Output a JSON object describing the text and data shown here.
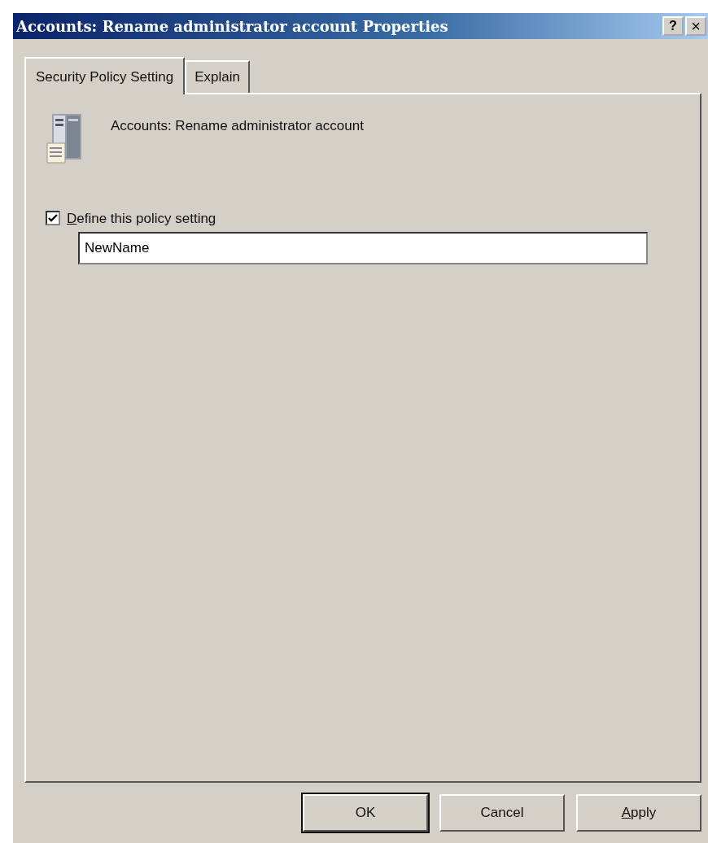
{
  "window": {
    "title": "Accounts: Rename administrator account Properties",
    "controls": [
      {
        "kind": "help",
        "label": "?"
      },
      {
        "kind": "close",
        "label": "×"
      }
    ]
  },
  "tabs": [
    {
      "label": "Security Policy Setting",
      "selected": true
    },
    {
      "label": "Explain",
      "selected": false
    }
  ],
  "policy": {
    "name": "Accounts: Rename administrator account"
  },
  "define": {
    "label": "Define this policy setting",
    "checked": true,
    "mnemonic": true
  },
  "value_field": {
    "value": "NewName"
  },
  "buttons": [
    {
      "label": "OK",
      "default": true,
      "mnemonic": false
    },
    {
      "label": "Cancel",
      "default": false,
      "mnemonic": false
    },
    {
      "label": "Apply",
      "default": false,
      "mnemonic": true
    }
  ]
}
